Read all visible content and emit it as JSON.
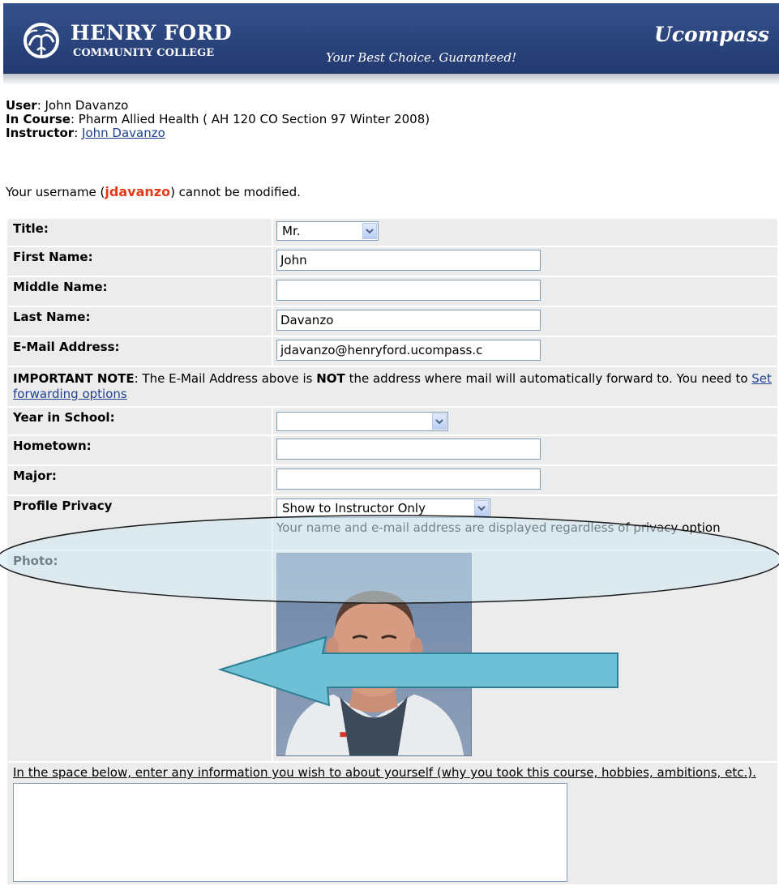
{
  "header": {
    "college_name": "HENRY FORD",
    "college_sub": "COMMUNITY COLLEGE",
    "slogan": "Your Best Choice. Guaranteed!",
    "brand": "Ucompass"
  },
  "info": {
    "user_label": "User",
    "user_value": ": John Davanzo",
    "course_label": "In Course",
    "course_value": ": Pharm Allied Health ( AH 120 CO Section 97 Winter 2008)",
    "instructor_label": "Instructor",
    "instructor_sep": ": ",
    "instructor_link": "John Davanzo",
    "username_prefix": "Your username (",
    "username": "jdavanzo",
    "username_suffix": ") cannot be modified."
  },
  "form": {
    "title_label": "Title:",
    "title_value": "Mr.",
    "first_name_label": "First Name:",
    "first_name_value": "John",
    "middle_name_label": "Middle Name:",
    "middle_name_value": "",
    "last_name_label": "Last Name:",
    "last_name_value": "Davanzo",
    "email_label": "E-Mail Address:",
    "email_value": "jdavanzo@henryford.ucompass.c",
    "note_strong": "IMPORTANT NOTE",
    "note_text_1": ": The E-Mail Address above is ",
    "note_not": "NOT",
    "note_text_2": " the address where mail will automatically forward to. You need to ",
    "note_link": "Set forwarding options",
    "year_label": "Year in School:",
    "year_value": "",
    "hometown_label": "Hometown:",
    "hometown_value": "",
    "major_label": "Major:",
    "major_value": "",
    "privacy_label": "Profile Privacy",
    "privacy_value": "Show to Instructor Only",
    "privacy_help": "Your name and e-mail address are displayed regardless of privacy option",
    "photo_label": "Photo:",
    "about_text": "In the space below, enter any information you wish to about yourself (why you took this course, hobbies, ambitions, etc.)."
  },
  "colors": {
    "banner": "#2b457f",
    "username": "#e43a1b",
    "link": "#1f3f8f",
    "highlight_fill": "#cfe9f4",
    "arrow_fill": "#6ec0d6"
  }
}
